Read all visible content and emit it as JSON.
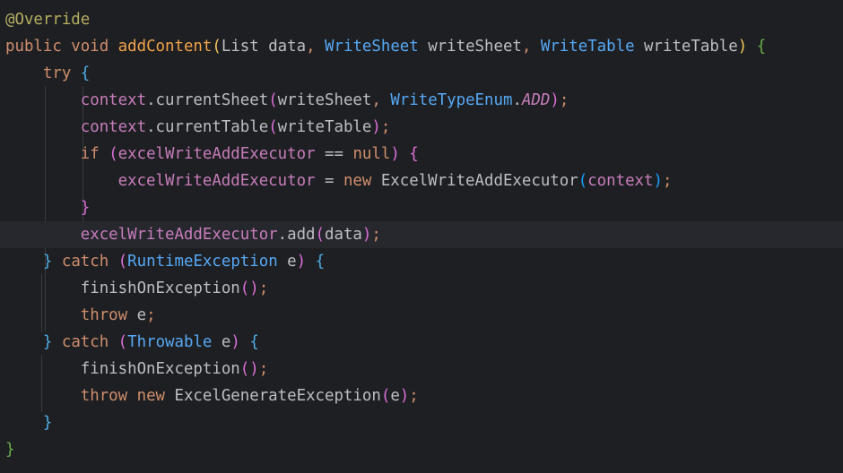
{
  "editor": {
    "colors": {
      "background": "#1e1f22",
      "current_line": "#26282e",
      "keyword": "#cf8e6d",
      "annotation": "#b3ae60",
      "type": "#56a8f5",
      "field": "#c77dbb",
      "text": "#bcbec4"
    },
    "lines": [
      [
        {
          "t": "@Override",
          "c": "ann"
        }
      ],
      [
        {
          "t": "public ",
          "c": "kw"
        },
        {
          "t": "void ",
          "c": "kw"
        },
        {
          "t": "addContent",
          "c": "decl"
        },
        {
          "t": "(",
          "c": "p1"
        },
        {
          "t": "List data",
          "c": "default"
        },
        {
          "t": ", ",
          "c": "comma"
        },
        {
          "t": "WriteSheet",
          "c": "type"
        },
        {
          "t": " writeSheet",
          "c": "default"
        },
        {
          "t": ", ",
          "c": "comma"
        },
        {
          "t": "WriteTable",
          "c": "type"
        },
        {
          "t": " writeTable",
          "c": "default"
        },
        {
          "t": ")",
          "c": "p1"
        },
        {
          "t": " ",
          "c": "default"
        },
        {
          "t": "{",
          "c": "b2"
        }
      ],
      [
        {
          "t": "    try ",
          "c": "kw"
        },
        {
          "t": "{",
          "c": "b1"
        }
      ],
      [
        {
          "t": "        ",
          "c": "default"
        },
        {
          "t": "context",
          "c": "fld"
        },
        {
          "t": ".currentSheet",
          "c": "default"
        },
        {
          "t": "(",
          "c": "p2"
        },
        {
          "t": "writeSheet",
          "c": "default"
        },
        {
          "t": ", ",
          "c": "comma"
        },
        {
          "t": "WriteTypeEnum",
          "c": "type"
        },
        {
          "t": ".",
          "c": "default"
        },
        {
          "t": "ADD",
          "c": "const"
        },
        {
          "t": ")",
          "c": "p2"
        },
        {
          "t": ";",
          "c": "semi"
        }
      ],
      [
        {
          "t": "        ",
          "c": "default"
        },
        {
          "t": "context",
          "c": "fld"
        },
        {
          "t": ".currentTable",
          "c": "default"
        },
        {
          "t": "(",
          "c": "p2"
        },
        {
          "t": "writeTable",
          "c": "default"
        },
        {
          "t": ")",
          "c": "p2"
        },
        {
          "t": ";",
          "c": "semi"
        }
      ],
      [
        {
          "t": "        ",
          "c": "default"
        },
        {
          "t": "if ",
          "c": "kw"
        },
        {
          "t": "(",
          "c": "p2"
        },
        {
          "t": "excelWriteAddExecutor",
          "c": "fld"
        },
        {
          "t": " == ",
          "c": "default"
        },
        {
          "t": "null",
          "c": "kw"
        },
        {
          "t": ")",
          "c": "p2"
        },
        {
          "t": " ",
          "c": "default"
        },
        {
          "t": "{",
          "c": "p2"
        }
      ],
      [
        {
          "t": "            ",
          "c": "default"
        },
        {
          "t": "excelWriteAddExecutor",
          "c": "fld"
        },
        {
          "t": " = ",
          "c": "default"
        },
        {
          "t": "new ",
          "c": "kw"
        },
        {
          "t": "ExcelWriteAddExecutor",
          "c": "default"
        },
        {
          "t": "(",
          "c": "p3"
        },
        {
          "t": "context",
          "c": "fld"
        },
        {
          "t": ")",
          "c": "p3"
        },
        {
          "t": ";",
          "c": "semi"
        }
      ],
      [
        {
          "t": "        ",
          "c": "default"
        },
        {
          "t": "}",
          "c": "p2"
        }
      ],
      [
        {
          "t": "        ",
          "c": "default"
        },
        {
          "t": "excelWriteAddExecutor",
          "c": "fld"
        },
        {
          "t": ".add",
          "c": "default"
        },
        {
          "t": "(",
          "c": "p2"
        },
        {
          "t": "data",
          "c": "default"
        },
        {
          "t": ")",
          "c": "p2"
        },
        {
          "t": ";",
          "c": "semi"
        }
      ],
      [
        {
          "t": "    ",
          "c": "default"
        },
        {
          "t": "}",
          "c": "b1"
        },
        {
          "t": " catch ",
          "c": "kw"
        },
        {
          "t": "(",
          "c": "p2"
        },
        {
          "t": "RuntimeException",
          "c": "type"
        },
        {
          "t": " e",
          "c": "default"
        },
        {
          "t": ")",
          "c": "p2"
        },
        {
          "t": " ",
          "c": "default"
        },
        {
          "t": "{",
          "c": "b1"
        }
      ],
      [
        {
          "t": "        ",
          "c": "default"
        },
        {
          "t": "finishOnException",
          "c": "default"
        },
        {
          "t": "(",
          "c": "p2"
        },
        {
          "t": ")",
          "c": "p2"
        },
        {
          "t": ";",
          "c": "semi"
        }
      ],
      [
        {
          "t": "        ",
          "c": "default"
        },
        {
          "t": "throw ",
          "c": "kw"
        },
        {
          "t": "e",
          "c": "default"
        },
        {
          "t": ";",
          "c": "semi"
        }
      ],
      [
        {
          "t": "    ",
          "c": "default"
        },
        {
          "t": "}",
          "c": "b1"
        },
        {
          "t": " catch ",
          "c": "kw"
        },
        {
          "t": "(",
          "c": "p2"
        },
        {
          "t": "Throwable",
          "c": "type"
        },
        {
          "t": " e",
          "c": "default"
        },
        {
          "t": ")",
          "c": "p2"
        },
        {
          "t": " ",
          "c": "default"
        },
        {
          "t": "{",
          "c": "b1"
        }
      ],
      [
        {
          "t": "        ",
          "c": "default"
        },
        {
          "t": "finishOnException",
          "c": "default"
        },
        {
          "t": "(",
          "c": "p2"
        },
        {
          "t": ")",
          "c": "p2"
        },
        {
          "t": ";",
          "c": "semi"
        }
      ],
      [
        {
          "t": "        ",
          "c": "default"
        },
        {
          "t": "throw ",
          "c": "kw"
        },
        {
          "t": "new ",
          "c": "kw"
        },
        {
          "t": "ExcelGenerateException",
          "c": "default"
        },
        {
          "t": "(",
          "c": "p2"
        },
        {
          "t": "e",
          "c": "default"
        },
        {
          "t": ")",
          "c": "p2"
        },
        {
          "t": ";",
          "c": "semi"
        }
      ],
      [
        {
          "t": "    ",
          "c": "default"
        },
        {
          "t": "}",
          "c": "b1"
        }
      ],
      [
        {
          "t": "}",
          "c": "b2"
        }
      ]
    ]
  }
}
